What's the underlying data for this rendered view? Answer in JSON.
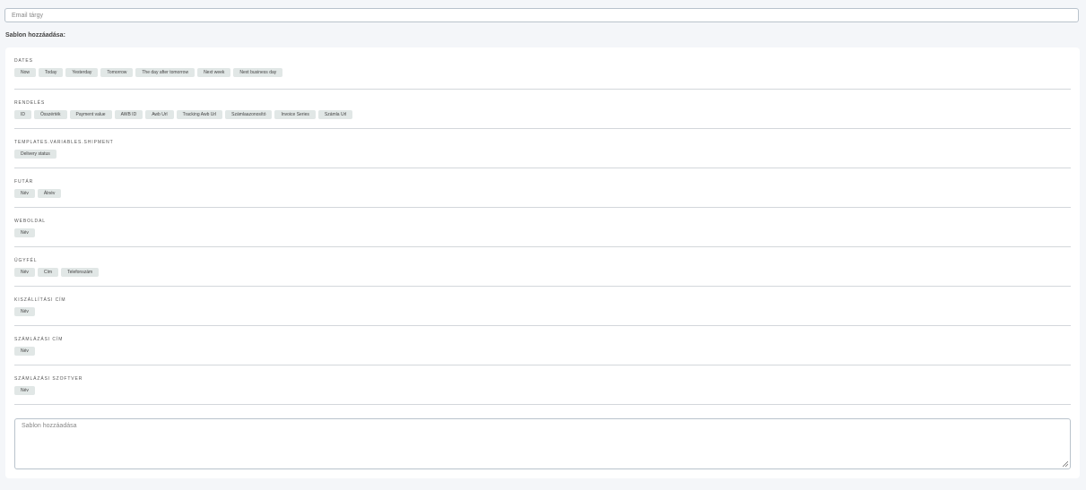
{
  "subject": {
    "placeholder": "Email tárgy"
  },
  "add_template_title": "Sablon hozzáadása:",
  "groups": [
    {
      "label": "DATES",
      "chips": [
        "Now",
        "Today",
        "Yesterday",
        "Tomorrow",
        "The day after tomorrow",
        "Next week",
        "Next business day"
      ]
    },
    {
      "label": "RENDELÉS",
      "chips": [
        "ID",
        "Összérték",
        "Payment value",
        "AWB ID",
        "Awb Url",
        "Tracking Awb Url",
        "Számlaazonosító",
        "Invoice Series",
        "Számla Url"
      ]
    },
    {
      "label": "TEMPLATES.VARIABLES.SHIPMENT",
      "chips": [
        "Delivery status"
      ]
    },
    {
      "label": "FUTÁR",
      "chips": [
        "Név",
        "Álnév"
      ]
    },
    {
      "label": "WEBOLDAL",
      "chips": [
        "Név"
      ]
    },
    {
      "label": "ÜGYFÉL",
      "chips": [
        "Név",
        "Cím",
        "Telefonszám"
      ]
    },
    {
      "label": "KISZÁLLÍTÁSI CÍM",
      "chips": [
        "Név"
      ]
    },
    {
      "label": "SZÁMLÁZÁSI CÍM",
      "chips": [
        "Név"
      ]
    },
    {
      "label": "SZÁMLÁZÁSI SZOFTVER",
      "chips": [
        "Név"
      ]
    }
  ],
  "template_area": {
    "placeholder": "Sablon hozzáadása"
  }
}
